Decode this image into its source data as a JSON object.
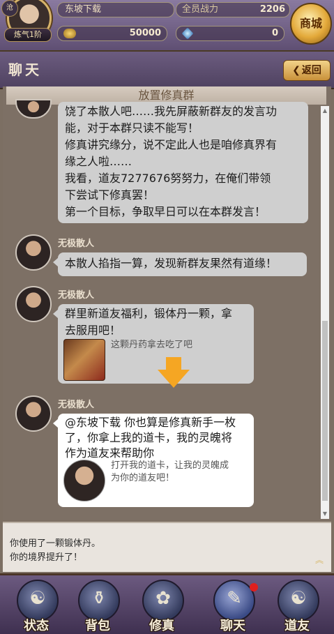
{
  "header": {
    "avatar_badge": "沧",
    "level": "炼气1阶",
    "player_name": "东坡下载",
    "power_label": "全员战力",
    "power_value": "2206",
    "gold": "50000",
    "gems": "0",
    "shop_label": "商城"
  },
  "titlebar": {
    "title": "聊天",
    "back_label": "返回"
  },
  "chat": {
    "group_button": "放置修真群",
    "messages": [
      {
        "sender": "",
        "lines": [
          "饶了本散人吧……我先屏蔽新群友的发言功",
          "能，对于本群只读不能写！",
          "修真讲究缘分，说不定此人也是咱修真界有",
          "缘之人啦……",
          "我看，道友7277676努努力，在俺们带领",
          "下尝试下修真罢！",
          "第一个目标，争取早日可以在本群发言！"
        ]
      },
      {
        "sender": "无极散人",
        "lines": [
          "本散人掐指一算，发现新群友果然有道缘！"
        ]
      },
      {
        "sender": "无极散人",
        "lines": [
          "群里新道友福利，锻体丹一颗，拿",
          "去服用吧！"
        ],
        "card_text": "这颗丹药拿去吃了吧"
      },
      {
        "sender": "无极散人",
        "lines": [
          "@东坡下载 你也算是修真新手一枚",
          "了，你拿上我的道卡，我的灵魄将",
          "作为道友来帮助你"
        ],
        "card_lines": [
          "打开我的道卡，让我的灵魄成",
          "为你的道友吧！"
        ]
      }
    ]
  },
  "log": {
    "lines": [
      "你使用了一颗锻体丹。",
      "你的境界提升了！"
    ]
  },
  "nav": [
    {
      "label": "状态",
      "glyph": "☯"
    },
    {
      "label": "背包",
      "glyph": "⚱"
    },
    {
      "label": "修真",
      "glyph": "✿"
    },
    {
      "label": "聊天",
      "glyph": "✎"
    },
    {
      "label": "道友",
      "glyph": "☯"
    }
  ],
  "colors": {
    "accent_gold": "#e3a93a",
    "hint_arrow": "#f5a623",
    "notification_dot": "#e0201e"
  }
}
